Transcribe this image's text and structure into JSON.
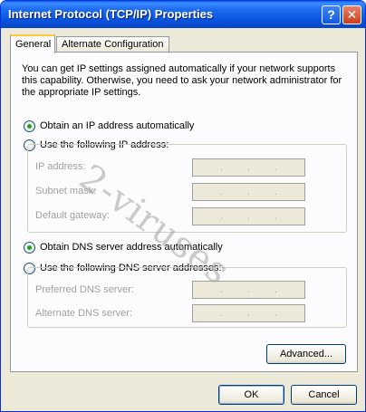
{
  "window": {
    "title": "Internet Protocol (TCP/IP) Properties",
    "help_glyph": "?",
    "close_glyph": "✕"
  },
  "tabs": [
    {
      "label": "General",
      "active": true
    },
    {
      "label": "Alternate Configuration",
      "active": false
    }
  ],
  "intro_text": "You can get IP settings assigned automatically if your network supports this capability. Otherwise, you need to ask your network administrator for the appropriate IP settings.",
  "ip_section": {
    "auto_label": "Obtain an IP address automatically",
    "manual_label": "Use the following IP address:",
    "selected": "auto",
    "fields": [
      {
        "label": "IP address:"
      },
      {
        "label": "Subnet mask:"
      },
      {
        "label": "Default gateway:"
      }
    ]
  },
  "dns_section": {
    "auto_label": "Obtain DNS server address automatically",
    "manual_label": "Use the following DNS server addresses:",
    "selected": "auto",
    "fields": [
      {
        "label": "Preferred DNS server:"
      },
      {
        "label": "Alternate DNS server:"
      }
    ]
  },
  "buttons": {
    "advanced": "Advanced...",
    "ok": "OK",
    "cancel": "Cancel"
  },
  "watermark": "2-viruses",
  "colors": {
    "title_bar": "#0a54e0",
    "dialog_bg": "#ece9d8",
    "radio_dot": "#21a121",
    "disabled_text": "#a0a0a0"
  }
}
